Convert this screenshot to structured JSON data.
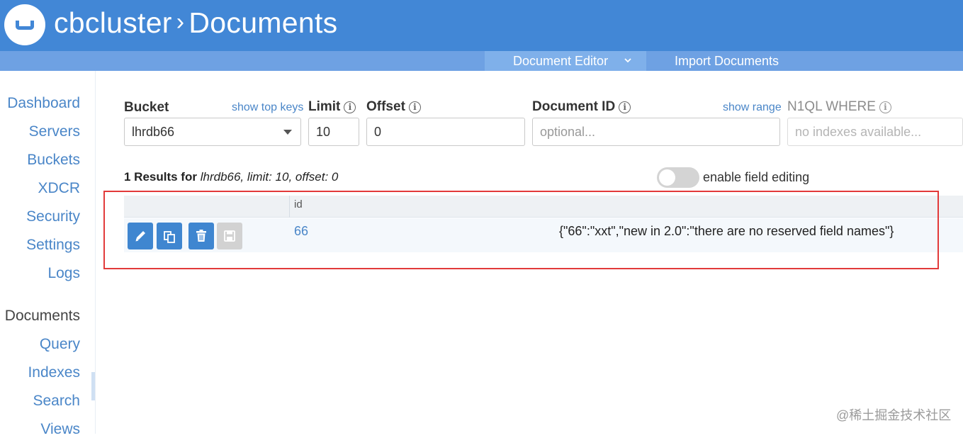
{
  "header": {
    "cluster": "cbcluster",
    "separator": "›",
    "page": "Documents"
  },
  "subnav": {
    "document_editor": "Document Editor",
    "import_documents": "Import Documents"
  },
  "sidebar": {
    "items": [
      {
        "label": "Dashboard"
      },
      {
        "label": "Servers"
      },
      {
        "label": "Buckets"
      },
      {
        "label": "XDCR"
      },
      {
        "label": "Security"
      },
      {
        "label": "Settings"
      },
      {
        "label": "Logs"
      },
      {
        "label": "Documents",
        "active": true
      },
      {
        "label": "Query"
      },
      {
        "label": "Indexes"
      },
      {
        "label": "Search"
      },
      {
        "label": "Views"
      }
    ]
  },
  "filters": {
    "bucket_label": "Bucket",
    "show_top_keys": "show top keys",
    "bucket_value": "lhrdb66",
    "limit_label": "Limit",
    "limit_value": "10",
    "offset_label": "Offset",
    "offset_value": "0",
    "docid_label": "Document ID",
    "show_range": "show range",
    "docid_placeholder": "optional...",
    "where_label": "N1QL WHERE",
    "where_placeholder": "no indexes available..."
  },
  "results": {
    "count_text": "1 Results for",
    "detail_text": "lhrdb66, limit: 10, offset: 0",
    "enable_field_editing": "enable field editing",
    "editing_enabled": false,
    "column_id": "id",
    "rows": [
      {
        "id": "66",
        "json": "{\"66\":\"xxt\",\"new in 2.0\":\"there are no reserved field names\"}"
      }
    ]
  },
  "icons": {
    "edit": "pencil-icon",
    "copy": "copy-icon",
    "delete": "trash-icon",
    "save": "save-icon"
  },
  "colors": {
    "header": "#4287d6",
    "subnav": "#6ea1e3",
    "link": "#4a86c8",
    "button": "#3f86d0",
    "highlight": "#e23a3a"
  },
  "watermark": "@稀土掘金技术社区"
}
